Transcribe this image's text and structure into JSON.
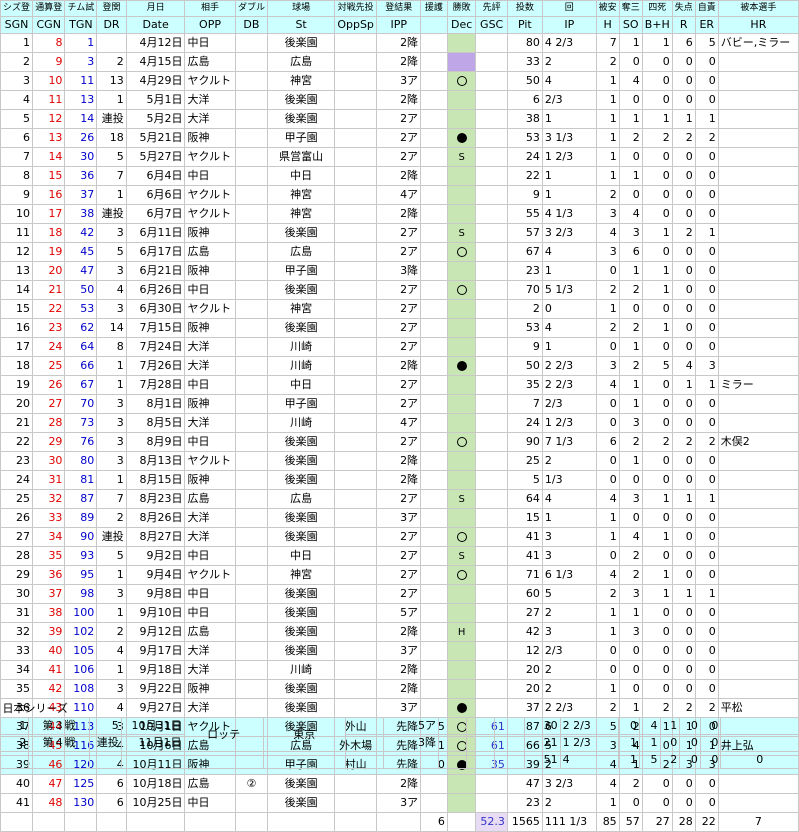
{
  "header_jp": [
    "シズ登",
    "通算登",
    "チム試",
    "登関",
    "月日",
    "相手",
    "ダブル",
    "球場",
    "対戦先投",
    "登結果",
    "援護",
    "勝敗",
    "先評",
    "投数",
    "回",
    "被安",
    "奪三",
    "四死",
    "失点",
    "自責",
    "被本選手"
  ],
  "header_en": [
    "SGN",
    "CGN",
    "TGN",
    "DR",
    "Date",
    "OPP",
    "DB",
    "St",
    "OppSp",
    "IPP",
    "",
    "Dec",
    "GSC",
    "Pit",
    "IP",
    "H",
    "SO",
    "B+H",
    "R",
    "ER",
    "HR"
  ],
  "rows": [
    {
      "sgn": "1",
      "cgn": "8",
      "tgn": "1",
      "dr": "",
      "date": "4月12日",
      "opp": "中日",
      "db": "",
      "st": "後楽園",
      "oppsp": "",
      "ipp": "2降",
      "sup": "",
      "dec": "",
      "gsc": "",
      "pit": "80",
      "ip": "4 2/3",
      "h": "7",
      "so": "1",
      "bh": "1",
      "r": "6",
      "er": "5",
      "hr": "バビー,ミラー"
    },
    {
      "sgn": "2",
      "cgn": "9",
      "tgn": "3",
      "dr": "2",
      "date": "4月15日",
      "opp": "広島",
      "db": "",
      "st": "広島",
      "oppsp": "",
      "ipp": "2降",
      "sup": "",
      "dec": "",
      "gsc": "",
      "pit": "33",
      "ip": "2",
      "h": "2",
      "so": "0",
      "bh": "0",
      "r": "0",
      "er": "0",
      "hr": ""
    },
    {
      "sgn": "3",
      "cgn": "10",
      "tgn": "11",
      "dr": "13",
      "date": "4月29日",
      "opp": "ヤクルト",
      "db": "",
      "st": "神宮",
      "oppsp": "",
      "ipp": "3ア",
      "sup": "",
      "dec": "○",
      "gsc": "",
      "pit": "50",
      "ip": "4",
      "h": "1",
      "so": "4",
      "bh": "0",
      "r": "0",
      "er": "0",
      "hr": ""
    },
    {
      "sgn": "4",
      "cgn": "11",
      "tgn": "13",
      "dr": "1",
      "date": "5月1日",
      "opp": "大洋",
      "db": "",
      "st": "後楽園",
      "oppsp": "",
      "ipp": "2降",
      "sup": "",
      "dec": "",
      "gsc": "",
      "pit": "6",
      "ip": "2/3",
      "h": "1",
      "so": "0",
      "bh": "0",
      "r": "0",
      "er": "0",
      "hr": ""
    },
    {
      "sgn": "5",
      "cgn": "12",
      "tgn": "14",
      "dr": "連投",
      "date": "5月2日",
      "opp": "大洋",
      "db": "",
      "st": "後楽園",
      "oppsp": "",
      "ipp": "2ア",
      "sup": "",
      "dec": "",
      "gsc": "",
      "pit": "38",
      "ip": "1",
      "h": "1",
      "so": "1",
      "bh": "1",
      "r": "1",
      "er": "1",
      "hr": ""
    },
    {
      "sgn": "6",
      "cgn": "13",
      "tgn": "26",
      "dr": "18",
      "date": "5月21日",
      "opp": "阪神",
      "db": "",
      "st": "甲子園",
      "oppsp": "",
      "ipp": "2ア",
      "sup": "",
      "dec": "●",
      "gsc": "",
      "pit": "53",
      "ip": "3 1/3",
      "h": "1",
      "so": "2",
      "bh": "2",
      "r": "2",
      "er": "2",
      "hr": ""
    },
    {
      "sgn": "7",
      "cgn": "14",
      "tgn": "30",
      "dr": "5",
      "date": "5月27日",
      "opp": "ヤクルト",
      "db": "",
      "st": "県営富山",
      "oppsp": "",
      "ipp": "2ア",
      "sup": "",
      "dec": "S",
      "gsc": "",
      "pit": "24",
      "ip": "1 2/3",
      "h": "1",
      "so": "0",
      "bh": "0",
      "r": "0",
      "er": "0",
      "hr": ""
    },
    {
      "sgn": "8",
      "cgn": "15",
      "tgn": "36",
      "dr": "7",
      "date": "6月4日",
      "opp": "中日",
      "db": "",
      "st": "中日",
      "oppsp": "",
      "ipp": "2降",
      "sup": "",
      "dec": "",
      "gsc": "",
      "pit": "22",
      "ip": "1",
      "h": "1",
      "so": "1",
      "bh": "0",
      "r": "0",
      "er": "0",
      "hr": ""
    },
    {
      "sgn": "9",
      "cgn": "16",
      "tgn": "37",
      "dr": "1",
      "date": "6月6日",
      "opp": "ヤクルト",
      "db": "",
      "st": "神宮",
      "oppsp": "",
      "ipp": "4ア",
      "sup": "",
      "dec": "",
      "gsc": "",
      "pit": "9",
      "ip": "1",
      "h": "2",
      "so": "0",
      "bh": "0",
      "r": "0",
      "er": "0",
      "hr": ""
    },
    {
      "sgn": "10",
      "cgn": "17",
      "tgn": "38",
      "dr": "連投",
      "date": "6月7日",
      "opp": "ヤクルト",
      "db": "",
      "st": "神宮",
      "oppsp": "",
      "ipp": "2降",
      "sup": "",
      "dec": "",
      "gsc": "",
      "pit": "55",
      "ip": "4 1/3",
      "h": "3",
      "so": "4",
      "bh": "0",
      "r": "0",
      "er": "0",
      "hr": ""
    },
    {
      "sgn": "11",
      "cgn": "18",
      "tgn": "42",
      "dr": "3",
      "date": "6月11日",
      "opp": "阪神",
      "db": "",
      "st": "後楽園",
      "oppsp": "",
      "ipp": "2ア",
      "sup": "",
      "dec": "S",
      "gsc": "",
      "pit": "57",
      "ip": "3 2/3",
      "h": "4",
      "so": "3",
      "bh": "1",
      "r": "2",
      "er": "1",
      "hr": ""
    },
    {
      "sgn": "12",
      "cgn": "19",
      "tgn": "45",
      "dr": "5",
      "date": "6月17日",
      "opp": "広島",
      "db": "",
      "st": "広島",
      "oppsp": "",
      "ipp": "2ア",
      "sup": "",
      "dec": "○",
      "gsc": "",
      "pit": "67",
      "ip": "4",
      "h": "3",
      "so": "6",
      "bh": "0",
      "r": "0",
      "er": "0",
      "hr": ""
    },
    {
      "sgn": "13",
      "cgn": "20",
      "tgn": "47",
      "dr": "3",
      "date": "6月21日",
      "opp": "阪神",
      "db": "",
      "st": "甲子園",
      "oppsp": "",
      "ipp": "3降",
      "sup": "",
      "dec": "",
      "gsc": "",
      "pit": "23",
      "ip": "1",
      "h": "0",
      "so": "1",
      "bh": "1",
      "r": "0",
      "er": "0",
      "hr": ""
    },
    {
      "sgn": "14",
      "cgn": "21",
      "tgn": "50",
      "dr": "4",
      "date": "6月26日",
      "opp": "中日",
      "db": "",
      "st": "後楽園",
      "oppsp": "",
      "ipp": "2ア",
      "sup": "",
      "dec": "○",
      "gsc": "",
      "pit": "70",
      "ip": "5 1/3",
      "h": "2",
      "so": "2",
      "bh": "1",
      "r": "0",
      "er": "0",
      "hr": ""
    },
    {
      "sgn": "15",
      "cgn": "22",
      "tgn": "53",
      "dr": "3",
      "date": "6月30日",
      "opp": "ヤクルト",
      "db": "",
      "st": "神宮",
      "oppsp": "",
      "ipp": "2ア",
      "sup": "",
      "dec": "",
      "gsc": "",
      "pit": "2",
      "ip": "0",
      "h": "1",
      "so": "0",
      "bh": "0",
      "r": "0",
      "er": "0",
      "hr": ""
    },
    {
      "sgn": "16",
      "cgn": "23",
      "tgn": "62",
      "dr": "14",
      "date": "7月15日",
      "opp": "阪神",
      "db": "",
      "st": "後楽園",
      "oppsp": "",
      "ipp": "2ア",
      "sup": "",
      "dec": "",
      "gsc": "",
      "pit": "53",
      "ip": "4",
      "h": "2",
      "so": "2",
      "bh": "1",
      "r": "0",
      "er": "0",
      "hr": ""
    },
    {
      "sgn": "17",
      "cgn": "24",
      "tgn": "64",
      "dr": "8",
      "date": "7月24日",
      "opp": "大洋",
      "db": "",
      "st": "川崎",
      "oppsp": "",
      "ipp": "2ア",
      "sup": "",
      "dec": "",
      "gsc": "",
      "pit": "9",
      "ip": "1",
      "h": "0",
      "so": "1",
      "bh": "0",
      "r": "0",
      "er": "0",
      "hr": ""
    },
    {
      "sgn": "18",
      "cgn": "25",
      "tgn": "66",
      "dr": "1",
      "date": "7月26日",
      "opp": "大洋",
      "db": "",
      "st": "川崎",
      "oppsp": "",
      "ipp": "2降",
      "sup": "",
      "dec": "●",
      "gsc": "",
      "pit": "50",
      "ip": "2 2/3",
      "h": "3",
      "so": "2",
      "bh": "5",
      "r": "4",
      "er": "3",
      "hr": ""
    },
    {
      "sgn": "19",
      "cgn": "26",
      "tgn": "67",
      "dr": "1",
      "date": "7月28日",
      "opp": "中日",
      "db": "",
      "st": "中日",
      "oppsp": "",
      "ipp": "2ア",
      "sup": "",
      "dec": "",
      "gsc": "",
      "pit": "35",
      "ip": "2 2/3",
      "h": "4",
      "so": "1",
      "bh": "0",
      "r": "1",
      "er": "1",
      "hr": "ミラー"
    },
    {
      "sgn": "20",
      "cgn": "27",
      "tgn": "70",
      "dr": "3",
      "date": "8月1日",
      "opp": "阪神",
      "db": "",
      "st": "甲子園",
      "oppsp": "",
      "ipp": "2ア",
      "sup": "",
      "dec": "",
      "gsc": "",
      "pit": "7",
      "ip": "2/3",
      "h": "0",
      "so": "1",
      "bh": "0",
      "r": "0",
      "er": "0",
      "hr": ""
    },
    {
      "sgn": "21",
      "cgn": "28",
      "tgn": "73",
      "dr": "3",
      "date": "8月5日",
      "opp": "大洋",
      "db": "",
      "st": "川崎",
      "oppsp": "",
      "ipp": "4ア",
      "sup": "",
      "dec": "",
      "gsc": "",
      "pit": "24",
      "ip": "1 2/3",
      "h": "0",
      "so": "3",
      "bh": "0",
      "r": "0",
      "er": "0",
      "hr": ""
    },
    {
      "sgn": "22",
      "cgn": "29",
      "tgn": "76",
      "dr": "3",
      "date": "8月9日",
      "opp": "中日",
      "db": "",
      "st": "後楽園",
      "oppsp": "",
      "ipp": "2ア",
      "sup": "",
      "dec": "○",
      "gsc": "",
      "pit": "90",
      "ip": "7 1/3",
      "h": "6",
      "so": "2",
      "bh": "2",
      "r": "2",
      "er": "2",
      "hr": "木俣2"
    },
    {
      "sgn": "23",
      "cgn": "30",
      "tgn": "80",
      "dr": "3",
      "date": "8月13日",
      "opp": "ヤクルト",
      "db": "",
      "st": "後楽園",
      "oppsp": "",
      "ipp": "2降",
      "sup": "",
      "dec": "",
      "gsc": "",
      "pit": "25",
      "ip": "2",
      "h": "0",
      "so": "1",
      "bh": "0",
      "r": "0",
      "er": "0",
      "hr": ""
    },
    {
      "sgn": "24",
      "cgn": "31",
      "tgn": "81",
      "dr": "1",
      "date": "8月15日",
      "opp": "阪神",
      "db": "",
      "st": "後楽園",
      "oppsp": "",
      "ipp": "2降",
      "sup": "",
      "dec": "",
      "gsc": "",
      "pit": "5",
      "ip": "1/3",
      "h": "0",
      "so": "0",
      "bh": "0",
      "r": "0",
      "er": "0",
      "hr": ""
    },
    {
      "sgn": "25",
      "cgn": "32",
      "tgn": "87",
      "dr": "7",
      "date": "8月23日",
      "opp": "広島",
      "db": "",
      "st": "広島",
      "oppsp": "",
      "ipp": "2ア",
      "sup": "",
      "dec": "S",
      "gsc": "",
      "pit": "64",
      "ip": "4",
      "h": "4",
      "so": "3",
      "bh": "1",
      "r": "1",
      "er": "1",
      "hr": ""
    },
    {
      "sgn": "26",
      "cgn": "33",
      "tgn": "89",
      "dr": "2",
      "date": "8月26日",
      "opp": "大洋",
      "db": "",
      "st": "後楽園",
      "oppsp": "",
      "ipp": "3ア",
      "sup": "",
      "dec": "",
      "gsc": "",
      "pit": "15",
      "ip": "1",
      "h": "1",
      "so": "0",
      "bh": "0",
      "r": "0",
      "er": "0",
      "hr": ""
    },
    {
      "sgn": "27",
      "cgn": "34",
      "tgn": "90",
      "dr": "連投",
      "date": "8月27日",
      "opp": "大洋",
      "db": "",
      "st": "後楽園",
      "oppsp": "",
      "ipp": "2ア",
      "sup": "",
      "dec": "○",
      "gsc": "",
      "pit": "41",
      "ip": "3",
      "h": "1",
      "so": "4",
      "bh": "1",
      "r": "0",
      "er": "0",
      "hr": ""
    },
    {
      "sgn": "28",
      "cgn": "35",
      "tgn": "93",
      "dr": "5",
      "date": "9月2日",
      "opp": "中日",
      "db": "",
      "st": "中日",
      "oppsp": "",
      "ipp": "2ア",
      "sup": "",
      "dec": "S",
      "gsc": "",
      "pit": "41",
      "ip": "3",
      "h": "0",
      "so": "2",
      "bh": "0",
      "r": "0",
      "er": "0",
      "hr": ""
    },
    {
      "sgn": "29",
      "cgn": "36",
      "tgn": "95",
      "dr": "1",
      "date": "9月4日",
      "opp": "ヤクルト",
      "db": "",
      "st": "神宮",
      "oppsp": "",
      "ipp": "2ア",
      "sup": "",
      "dec": "○",
      "gsc": "",
      "pit": "71",
      "ip": "6 1/3",
      "h": "4",
      "so": "2",
      "bh": "1",
      "r": "0",
      "er": "0",
      "hr": ""
    },
    {
      "sgn": "30",
      "cgn": "37",
      "tgn": "98",
      "dr": "3",
      "date": "9月8日",
      "opp": "中日",
      "db": "",
      "st": "後楽園",
      "oppsp": "",
      "ipp": "2ア",
      "sup": "",
      "dec": "",
      "gsc": "",
      "pit": "60",
      "ip": "5",
      "h": "2",
      "so": "3",
      "bh": "1",
      "r": "1",
      "er": "1",
      "hr": ""
    },
    {
      "sgn": "31",
      "cgn": "38",
      "tgn": "100",
      "dr": "1",
      "date": "9月10日",
      "opp": "中日",
      "db": "",
      "st": "後楽園",
      "oppsp": "",
      "ipp": "5ア",
      "sup": "",
      "dec": "",
      "gsc": "",
      "pit": "27",
      "ip": "2",
      "h": "1",
      "so": "1",
      "bh": "0",
      "r": "0",
      "er": "0",
      "hr": ""
    },
    {
      "sgn": "32",
      "cgn": "39",
      "tgn": "102",
      "dr": "2",
      "date": "9月12日",
      "opp": "広島",
      "db": "",
      "st": "後楽園",
      "oppsp": "",
      "ipp": "2降",
      "sup": "",
      "dec": "H",
      "gsc": "",
      "pit": "42",
      "ip": "3",
      "h": "1",
      "so": "3",
      "bh": "0",
      "r": "0",
      "er": "0",
      "hr": ""
    },
    {
      "sgn": "33",
      "cgn": "40",
      "tgn": "105",
      "dr": "4",
      "date": "9月17日",
      "opp": "大洋",
      "db": "",
      "st": "後楽園",
      "oppsp": "",
      "ipp": "3ア",
      "sup": "",
      "dec": "",
      "gsc": "",
      "pit": "12",
      "ip": "2/3",
      "h": "0",
      "so": "0",
      "bh": "0",
      "r": "0",
      "er": "0",
      "hr": ""
    },
    {
      "sgn": "34",
      "cgn": "41",
      "tgn": "106",
      "dr": "1",
      "date": "9月18日",
      "opp": "大洋",
      "db": "",
      "st": "川崎",
      "oppsp": "",
      "ipp": "2降",
      "sup": "",
      "dec": "",
      "gsc": "",
      "pit": "20",
      "ip": "2",
      "h": "0",
      "so": "0",
      "bh": "0",
      "r": "0",
      "er": "0",
      "hr": ""
    },
    {
      "sgn": "35",
      "cgn": "42",
      "tgn": "108",
      "dr": "3",
      "date": "9月22日",
      "opp": "阪神",
      "db": "",
      "st": "後楽園",
      "oppsp": "",
      "ipp": "2降",
      "sup": "",
      "dec": "",
      "gsc": "",
      "pit": "20",
      "ip": "2",
      "h": "1",
      "so": "0",
      "bh": "0",
      "r": "0",
      "er": "0",
      "hr": ""
    },
    {
      "sgn": "36",
      "cgn": "43",
      "tgn": "110",
      "dr": "4",
      "date": "9月27日",
      "opp": "大洋",
      "db": "",
      "st": "後楽園",
      "oppsp": "",
      "ipp": "3ア",
      "sup": "",
      "dec": "●",
      "gsc": "",
      "pit": "37",
      "ip": "2 2/3",
      "h": "2",
      "so": "1",
      "bh": "2",
      "r": "2",
      "er": "2",
      "hr": "平松"
    },
    {
      "sgn": "37",
      "cgn": "44",
      "tgn": "113",
      "dr": "3",
      "date": "10月1日",
      "opp": "ヤクルト",
      "db": "",
      "st": "後楽園",
      "oppsp": "外山",
      "ipp": "先降",
      "sup": "5",
      "dec": "○",
      "gsc": "61",
      "pit": "87",
      "ip": "6",
      "h": "5",
      "so": "2",
      "bh": "1",
      "r": "1",
      "er": "0",
      "hr": "",
      "hl": true
    },
    {
      "sgn": "38",
      "cgn": "45",
      "tgn": "116",
      "dr": "4",
      "date": "10月6日",
      "opp": "広島",
      "db": "",
      "st": "広島",
      "oppsp": "外木場",
      "ipp": "先降",
      "sup": "1",
      "dec": "○",
      "gsc": "61",
      "pit": "66",
      "ip": "5",
      "h": "3",
      "so": "4",
      "bh": "0",
      "r": "1",
      "er": "1",
      "hr": "井上弘",
      "hl": true
    },
    {
      "sgn": "39",
      "cgn": "46",
      "tgn": "120",
      "dr": "4",
      "date": "10月11日",
      "opp": "阪神",
      "db": "",
      "st": "甲子園",
      "oppsp": "村山",
      "ipp": "先降",
      "sup": "0",
      "dec": "●",
      "gsc": "35",
      "pit": "39",
      "ip": "2",
      "h": "4",
      "so": "1",
      "bh": "2",
      "r": "3",
      "er": "3",
      "hr": "",
      "hl": true
    },
    {
      "sgn": "40",
      "cgn": "47",
      "tgn": "125",
      "dr": "6",
      "date": "10月18日",
      "opp": "広島",
      "db": "②",
      "st": "後楽園",
      "oppsp": "",
      "ipp": "2降",
      "sup": "",
      "dec": "",
      "gsc": "",
      "pit": "47",
      "ip": "3 2/3",
      "h": "4",
      "so": "2",
      "bh": "0",
      "r": "0",
      "er": "0",
      "hr": ""
    },
    {
      "sgn": "41",
      "cgn": "48",
      "tgn": "130",
      "dr": "6",
      "date": "10月25日",
      "opp": "中日",
      "db": "",
      "st": "後楽園",
      "oppsp": "",
      "ipp": "3ア",
      "sup": "",
      "dec": "",
      "gsc": "",
      "pit": "23",
      "ip": "2",
      "h": "1",
      "so": "0",
      "bh": "0",
      "r": "0",
      "er": "0",
      "hr": ""
    }
  ],
  "totals": {
    "sup": "6",
    "gsc": "52.3",
    "pit": "1565",
    "ip": "111 1/3",
    "h": "85",
    "so": "57",
    "bh": "27",
    "r": "28",
    "er": "22",
    "hr": "7"
  },
  "series": {
    "title": "日本シリーズ",
    "rows": [
      {
        "n": "1",
        "game": "第３戦",
        "dr": "5",
        "date": "10月31日",
        "pit": "30",
        "ip": "2 2/3",
        "h": "0",
        "so": "4",
        "bh": "1",
        "r": "0",
        "er": "0"
      },
      {
        "n": "2",
        "game": "第４戦",
        "dr": "連投",
        "date": "11月1日",
        "pit": "21",
        "ip": "1 2/3",
        "h": "1",
        "so": "1",
        "bh": "0",
        "r": "0",
        "er": "0"
      }
    ],
    "opp": "ロッテ",
    "st": "東京",
    "ipp": [
      "5ア",
      "3降"
    ],
    "totals": {
      "pit": "51",
      "ip": "4",
      "h": "1",
      "so": "5",
      "bh": "2",
      "r": "0",
      "er": "0",
      "hr": "0"
    }
  },
  "colors": {
    "header_bg": "#ccffff",
    "dec_green": "#c8e6b4",
    "dec_purple": "#bfa6e6",
    "cgn_red": "#e00000",
    "tgn_blue": "#0000cc",
    "gsc_blue": "#3333cc"
  }
}
